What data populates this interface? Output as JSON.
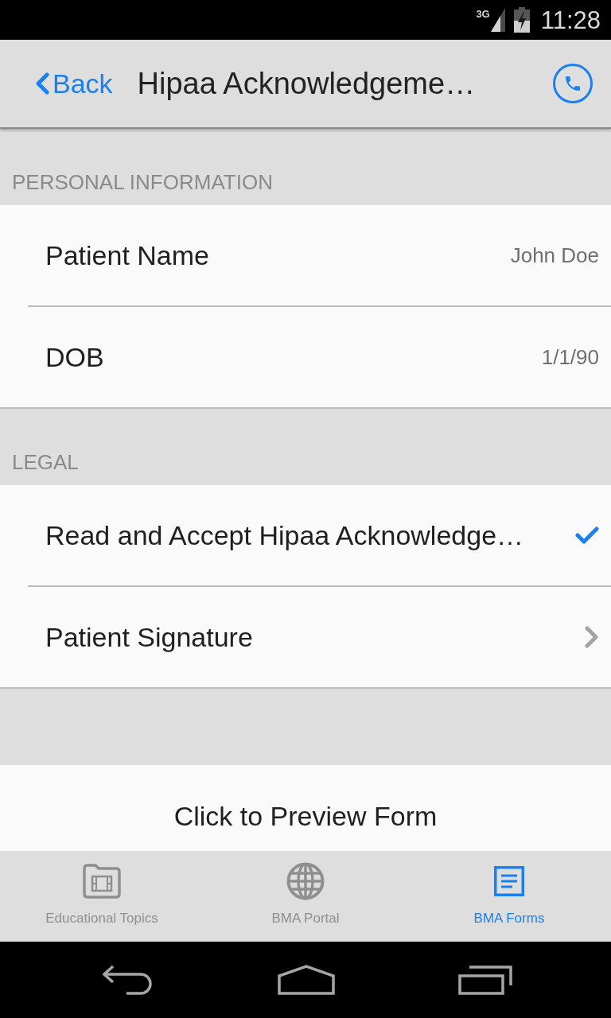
{
  "status_bar": {
    "network": "3G",
    "time": "11:28"
  },
  "nav_bar": {
    "back": "Back",
    "title": "Hipaa Acknowledgeme…"
  },
  "sections": [
    {
      "header": "PERSONAL INFORMATION",
      "rows": [
        {
          "kind": "value",
          "label": "Patient Name",
          "value": "John Doe"
        },
        {
          "kind": "value",
          "label": "DOB",
          "value": "1/1/90"
        }
      ]
    },
    {
      "header": "LEGAL",
      "rows": [
        {
          "kind": "check",
          "label": "Read and Accept Hipaa Acknowledge…",
          "checked": true
        },
        {
          "kind": "disclosure",
          "label": "Patient Signature"
        }
      ]
    }
  ],
  "preview": {
    "label": "Click to Preview Form"
  },
  "tabs": [
    {
      "label": "Educational Topics",
      "selected": false
    },
    {
      "label": "BMA Portal",
      "selected": false
    },
    {
      "label": "BMA Forms",
      "selected": true
    }
  ]
}
